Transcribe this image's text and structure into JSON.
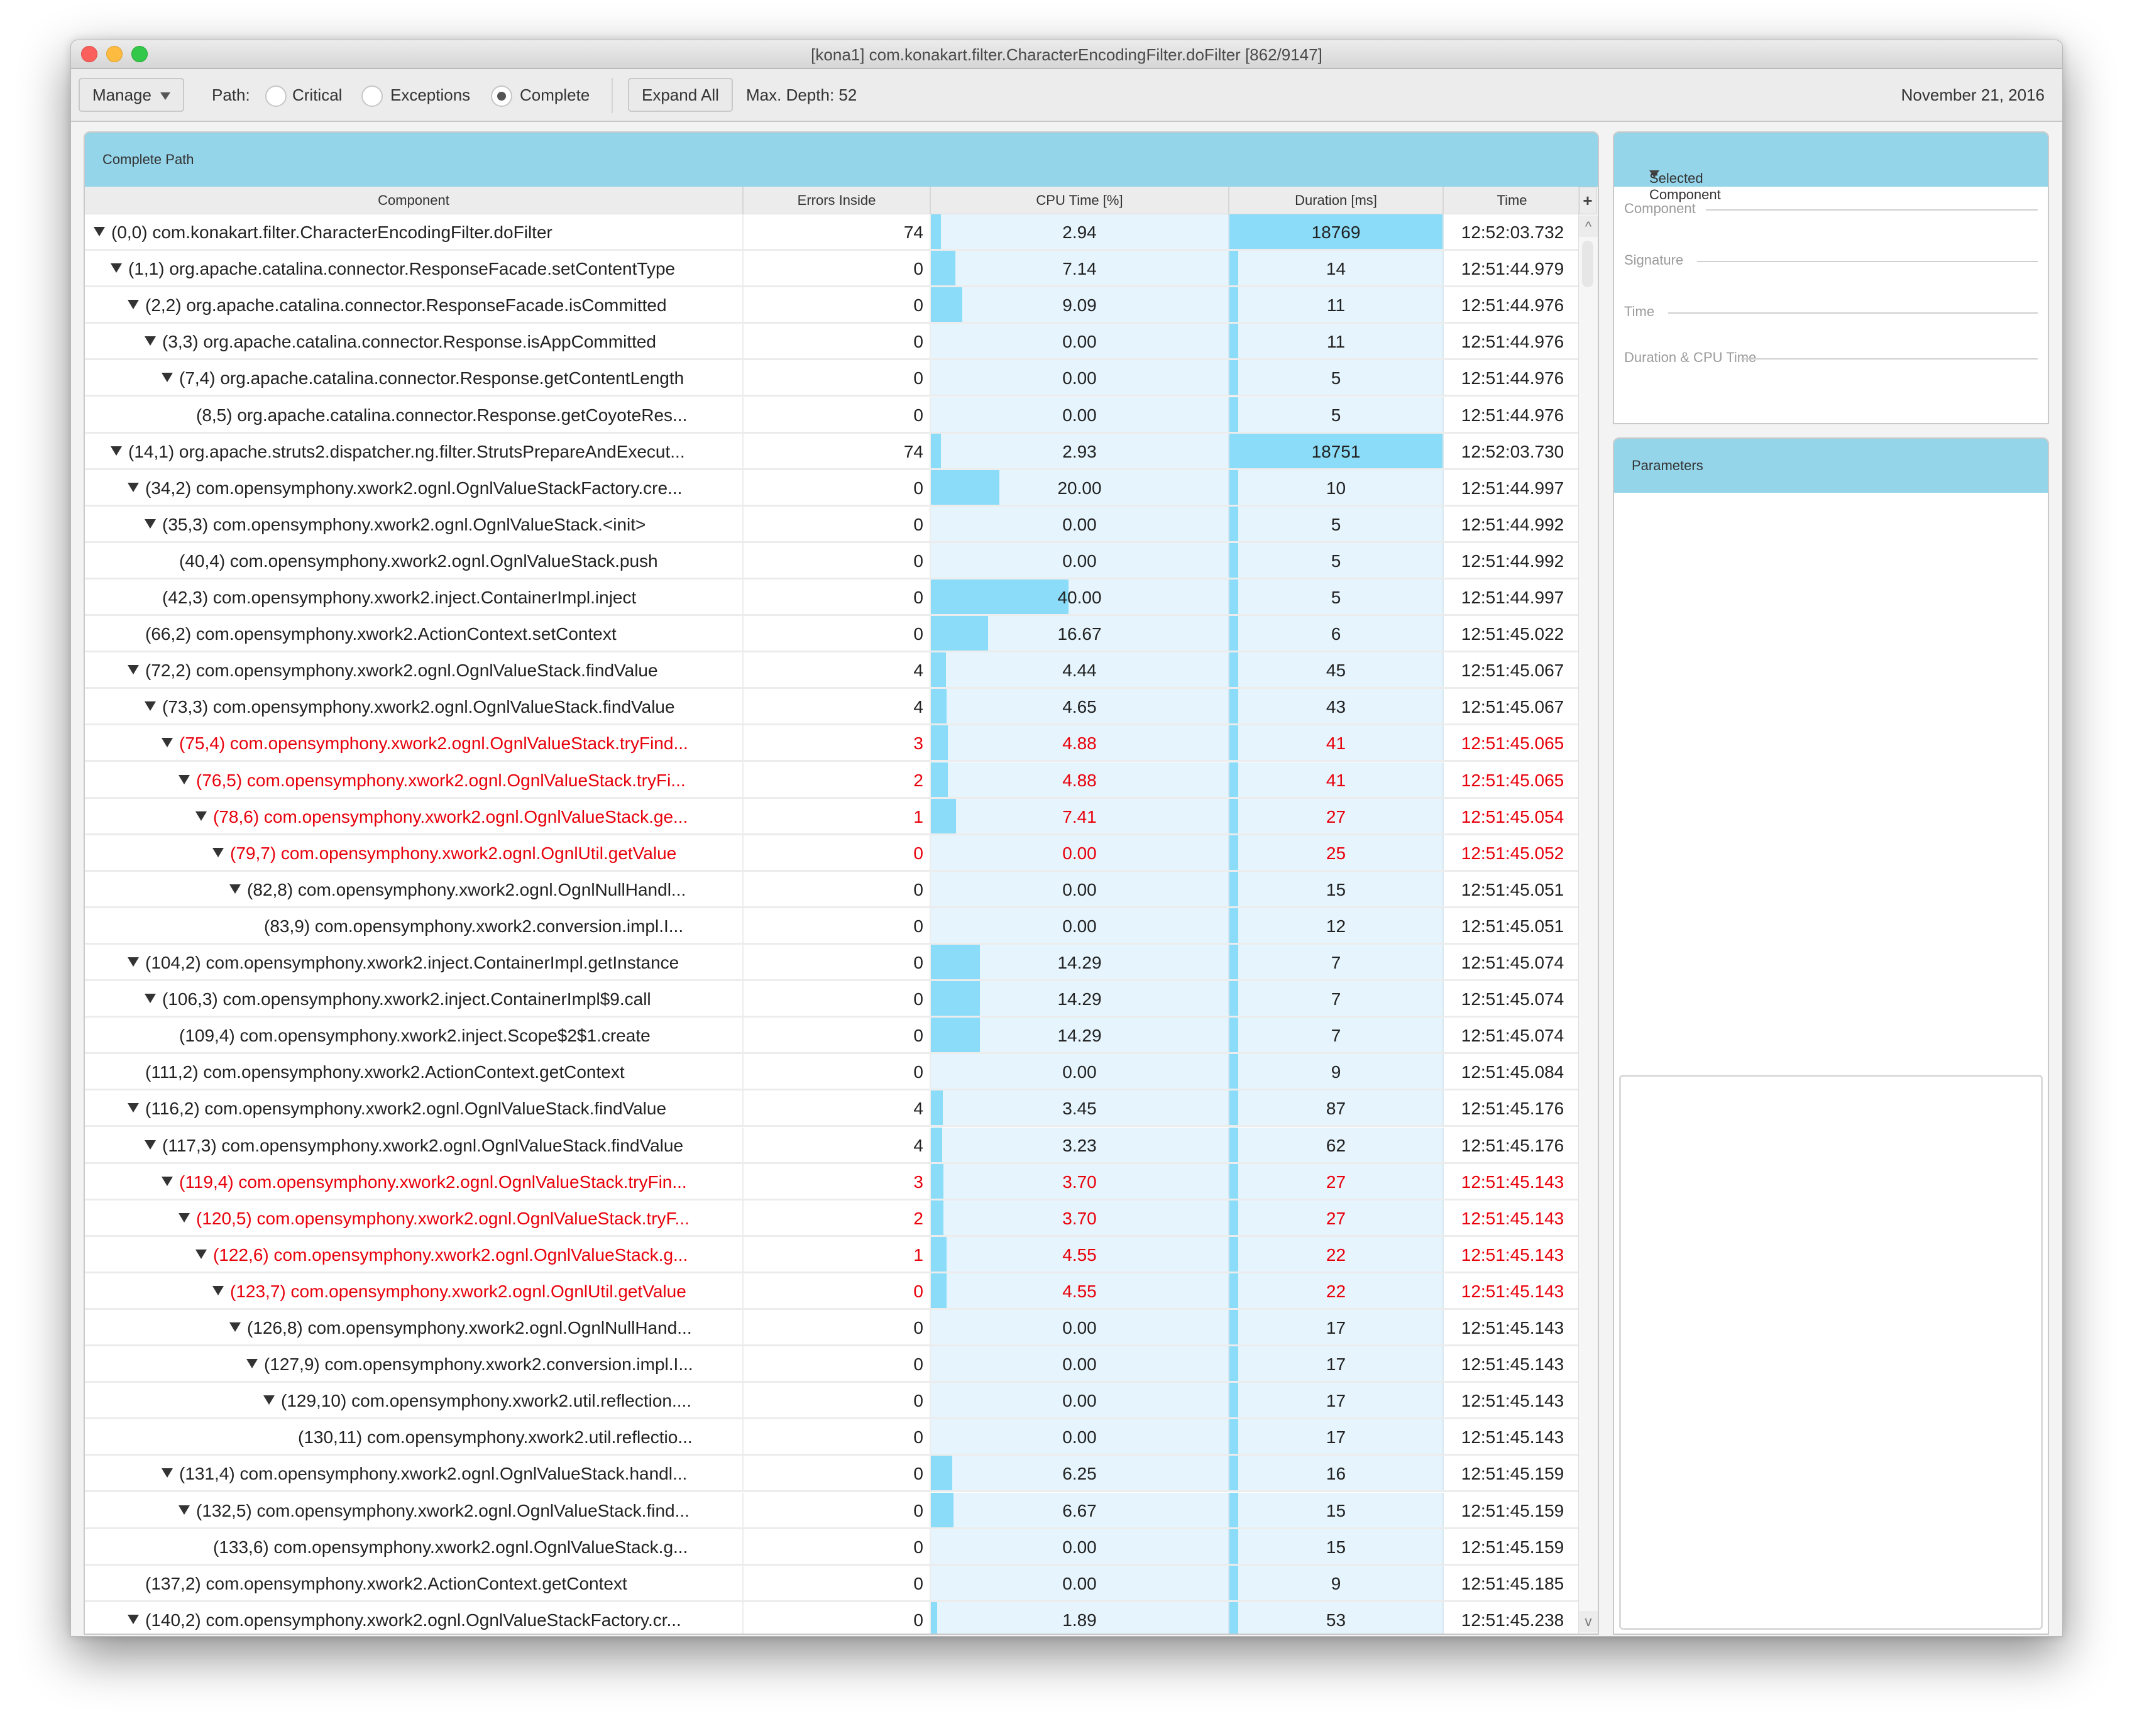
{
  "window": {
    "title": "[kona1] com.konakart.filter.CharacterEncodingFilter.doFilter [862/9147]"
  },
  "toolbar": {
    "manage_label": "Manage",
    "path_label": "Path:",
    "path_options": [
      {
        "label": "Critical",
        "selected": false
      },
      {
        "label": "Exceptions",
        "selected": false
      },
      {
        "label": "Complete",
        "selected": true
      }
    ],
    "expand_all_label": "Expand All",
    "max_depth_label": "Max. Depth: 52",
    "date": "November 21, 2016"
  },
  "main_panel": {
    "title": "Complete Path",
    "columns": [
      "Component",
      "Errors Inside",
      "CPU Time [%]",
      "Duration [ms]",
      "Time"
    ],
    "scroll_plus": "+",
    "scroll_up": "^",
    "scroll_down": "v",
    "rows": [
      {
        "depth": 0,
        "expandable": true,
        "error": false,
        "component": "(0,0) com.konakart.filter.CharacterEncodingFilter.doFilter",
        "errors": "74",
        "cpu": "2.94",
        "duration": "18769",
        "duration_highlight": true,
        "time": "12:52:03.732"
      },
      {
        "depth": 1,
        "expandable": true,
        "error": false,
        "component": "(1,1) org.apache.catalina.connector.ResponseFacade.setContentType",
        "errors": "0",
        "cpu": "7.14",
        "duration": "14",
        "time": "12:51:44.979"
      },
      {
        "depth": 2,
        "expandable": true,
        "error": false,
        "component": "(2,2) org.apache.catalina.connector.ResponseFacade.isCommitted",
        "errors": "0",
        "cpu": "9.09",
        "duration": "11",
        "time": "12:51:44.976"
      },
      {
        "depth": 3,
        "expandable": true,
        "error": false,
        "component": "(3,3) org.apache.catalina.connector.Response.isAppCommitted",
        "errors": "0",
        "cpu": "0.00",
        "duration": "11",
        "time": "12:51:44.976"
      },
      {
        "depth": 4,
        "expandable": true,
        "error": false,
        "component": "(7,4) org.apache.catalina.connector.Response.getContentLength",
        "errors": "0",
        "cpu": "0.00",
        "duration": "5",
        "time": "12:51:44.976"
      },
      {
        "depth": 5,
        "expandable": false,
        "error": false,
        "component": "(8,5) org.apache.catalina.connector.Response.getCoyoteRes...",
        "errors": "0",
        "cpu": "0.00",
        "duration": "5",
        "time": "12:51:44.976"
      },
      {
        "depth": 1,
        "expandable": true,
        "error": false,
        "component": "(14,1) org.apache.struts2.dispatcher.ng.filter.StrutsPrepareAndExecut...",
        "errors": "74",
        "cpu": "2.93",
        "duration": "18751",
        "duration_highlight": true,
        "time": "12:52:03.730"
      },
      {
        "depth": 2,
        "expandable": true,
        "error": false,
        "component": "(34,2) com.opensymphony.xwork2.ognl.OgnlValueStackFactory.cre...",
        "errors": "0",
        "cpu": "20.00",
        "duration": "10",
        "time": "12:51:44.997"
      },
      {
        "depth": 3,
        "expandable": true,
        "error": false,
        "component": "(35,3) com.opensymphony.xwork2.ognl.OgnlValueStack.<init>",
        "errors": "0",
        "cpu": "0.00",
        "duration": "5",
        "time": "12:51:44.992"
      },
      {
        "depth": 4,
        "expandable": false,
        "error": false,
        "component": "(40,4) com.opensymphony.xwork2.ognl.OgnlValueStack.push",
        "errors": "0",
        "cpu": "0.00",
        "duration": "5",
        "time": "12:51:44.992"
      },
      {
        "depth": 3,
        "expandable": false,
        "error": false,
        "component": "(42,3) com.opensymphony.xwork2.inject.ContainerImpl.inject",
        "errors": "0",
        "cpu": "40.00",
        "duration": "5",
        "time": "12:51:44.997"
      },
      {
        "depth": 2,
        "expandable": false,
        "error": false,
        "component": "(66,2) com.opensymphony.xwork2.ActionContext.setContext",
        "errors": "0",
        "cpu": "16.67",
        "duration": "6",
        "time": "12:51:45.022"
      },
      {
        "depth": 2,
        "expandable": true,
        "error": false,
        "component": "(72,2) com.opensymphony.xwork2.ognl.OgnlValueStack.findValue",
        "errors": "4",
        "cpu": "4.44",
        "duration": "45",
        "time": "12:51:45.067"
      },
      {
        "depth": 3,
        "expandable": true,
        "error": false,
        "component": "(73,3) com.opensymphony.xwork2.ognl.OgnlValueStack.findValue",
        "errors": "4",
        "cpu": "4.65",
        "duration": "43",
        "time": "12:51:45.067"
      },
      {
        "depth": 4,
        "expandable": true,
        "error": true,
        "component": "(75,4) com.opensymphony.xwork2.ognl.OgnlValueStack.tryFind...",
        "errors": "3",
        "cpu": "4.88",
        "duration": "41",
        "time": "12:51:45.065"
      },
      {
        "depth": 5,
        "expandable": true,
        "error": true,
        "component": "(76,5) com.opensymphony.xwork2.ognl.OgnlValueStack.tryFi...",
        "errors": "2",
        "cpu": "4.88",
        "duration": "41",
        "time": "12:51:45.065"
      },
      {
        "depth": 6,
        "expandable": true,
        "error": true,
        "component": "(78,6) com.opensymphony.xwork2.ognl.OgnlValueStack.ge...",
        "errors": "1",
        "cpu": "7.41",
        "duration": "27",
        "time": "12:51:45.054"
      },
      {
        "depth": 7,
        "expandable": true,
        "error": true,
        "component": "(79,7) com.opensymphony.xwork2.ognl.OgnlUtil.getValue",
        "errors": "0",
        "cpu": "0.00",
        "duration": "25",
        "time": "12:51:45.052"
      },
      {
        "depth": 8,
        "expandable": true,
        "error": false,
        "component": "(82,8) com.opensymphony.xwork2.ognl.OgnlNullHandl...",
        "errors": "0",
        "cpu": "0.00",
        "duration": "15",
        "time": "12:51:45.051"
      },
      {
        "depth": 9,
        "expandable": false,
        "error": false,
        "component": "(83,9) com.opensymphony.xwork2.conversion.impl.I...",
        "errors": "0",
        "cpu": "0.00",
        "duration": "12",
        "time": "12:51:45.051"
      },
      {
        "depth": 2,
        "expandable": true,
        "error": false,
        "component": "(104,2) com.opensymphony.xwork2.inject.ContainerImpl.getInstance",
        "errors": "0",
        "cpu": "14.29",
        "duration": "7",
        "time": "12:51:45.074"
      },
      {
        "depth": 3,
        "expandable": true,
        "error": false,
        "component": "(106,3) com.opensymphony.xwork2.inject.ContainerImpl$9.call",
        "errors": "0",
        "cpu": "14.29",
        "duration": "7",
        "time": "12:51:45.074"
      },
      {
        "depth": 4,
        "expandable": false,
        "error": false,
        "component": "(109,4) com.opensymphony.xwork2.inject.Scope$2$1.create",
        "errors": "0",
        "cpu": "14.29",
        "duration": "7",
        "time": "12:51:45.074"
      },
      {
        "depth": 2,
        "expandable": false,
        "error": false,
        "component": "(111,2) com.opensymphony.xwork2.ActionContext.getContext",
        "errors": "0",
        "cpu": "0.00",
        "duration": "9",
        "time": "12:51:45.084"
      },
      {
        "depth": 2,
        "expandable": true,
        "error": false,
        "component": "(116,2) com.opensymphony.xwork2.ognl.OgnlValueStack.findValue",
        "errors": "4",
        "cpu": "3.45",
        "duration": "87",
        "time": "12:51:45.176"
      },
      {
        "depth": 3,
        "expandable": true,
        "error": false,
        "component": "(117,3) com.opensymphony.xwork2.ognl.OgnlValueStack.findValue",
        "errors": "4",
        "cpu": "3.23",
        "duration": "62",
        "time": "12:51:45.176"
      },
      {
        "depth": 4,
        "expandable": true,
        "error": true,
        "component": "(119,4) com.opensymphony.xwork2.ognl.OgnlValueStack.tryFin...",
        "errors": "3",
        "cpu": "3.70",
        "duration": "27",
        "time": "12:51:45.143"
      },
      {
        "depth": 5,
        "expandable": true,
        "error": true,
        "component": "(120,5) com.opensymphony.xwork2.ognl.OgnlValueStack.tryF...",
        "errors": "2",
        "cpu": "3.70",
        "duration": "27",
        "time": "12:51:45.143"
      },
      {
        "depth": 6,
        "expandable": true,
        "error": true,
        "component": "(122,6) com.opensymphony.xwork2.ognl.OgnlValueStack.g...",
        "errors": "1",
        "cpu": "4.55",
        "duration": "22",
        "time": "12:51:45.143"
      },
      {
        "depth": 7,
        "expandable": true,
        "error": true,
        "component": "(123,7) com.opensymphony.xwork2.ognl.OgnlUtil.getValue",
        "errors": "0",
        "cpu": "4.55",
        "duration": "22",
        "time": "12:51:45.143"
      },
      {
        "depth": 8,
        "expandable": true,
        "error": false,
        "component": "(126,8) com.opensymphony.xwork2.ognl.OgnlNullHand...",
        "errors": "0",
        "cpu": "0.00",
        "duration": "17",
        "time": "12:51:45.143"
      },
      {
        "depth": 9,
        "expandable": true,
        "error": false,
        "component": "(127,9) com.opensymphony.xwork2.conversion.impl.I...",
        "errors": "0",
        "cpu": "0.00",
        "duration": "17",
        "time": "12:51:45.143"
      },
      {
        "depth": 10,
        "expandable": true,
        "error": false,
        "component": "(129,10) com.opensymphony.xwork2.util.reflection....",
        "errors": "0",
        "cpu": "0.00",
        "duration": "17",
        "time": "12:51:45.143"
      },
      {
        "depth": 11,
        "expandable": false,
        "error": false,
        "component": "(130,11) com.opensymphony.xwork2.util.reflectio...",
        "errors": "0",
        "cpu": "0.00",
        "duration": "17",
        "time": "12:51:45.143"
      },
      {
        "depth": 4,
        "expandable": true,
        "error": false,
        "component": "(131,4) com.opensymphony.xwork2.ognl.OgnlValueStack.handl...",
        "errors": "0",
        "cpu": "6.25",
        "duration": "16",
        "time": "12:51:45.159"
      },
      {
        "depth": 5,
        "expandable": true,
        "error": false,
        "component": "(132,5) com.opensymphony.xwork2.ognl.OgnlValueStack.find...",
        "errors": "0",
        "cpu": "6.67",
        "duration": "15",
        "time": "12:51:45.159"
      },
      {
        "depth": 6,
        "expandable": false,
        "error": false,
        "component": "(133,6) com.opensymphony.xwork2.ognl.OgnlValueStack.g...",
        "errors": "0",
        "cpu": "0.00",
        "duration": "15",
        "time": "12:51:45.159"
      },
      {
        "depth": 2,
        "expandable": false,
        "error": false,
        "component": "(137,2) com.opensymphony.xwork2.ActionContext.getContext",
        "errors": "0",
        "cpu": "0.00",
        "duration": "9",
        "time": "12:51:45.185"
      },
      {
        "depth": 2,
        "expandable": true,
        "error": false,
        "component": "(140,2) com.opensymphony.xwork2.ognl.OgnlValueStackFactory.cr...",
        "errors": "0",
        "cpu": "1.89",
        "duration": "53",
        "time": "12:51:45.238"
      }
    ]
  },
  "selected_component": {
    "title": "Selected Component",
    "fields": [
      "Component",
      "Signature",
      "Time",
      "Duration & CPU Time"
    ]
  },
  "parameters": {
    "title": "Parameters"
  },
  "colors": {
    "panel_header": "#95d5ea",
    "bar": "#8bdcf8",
    "cell_bg": "#e5f4fd",
    "error_text": "#e8000b"
  }
}
